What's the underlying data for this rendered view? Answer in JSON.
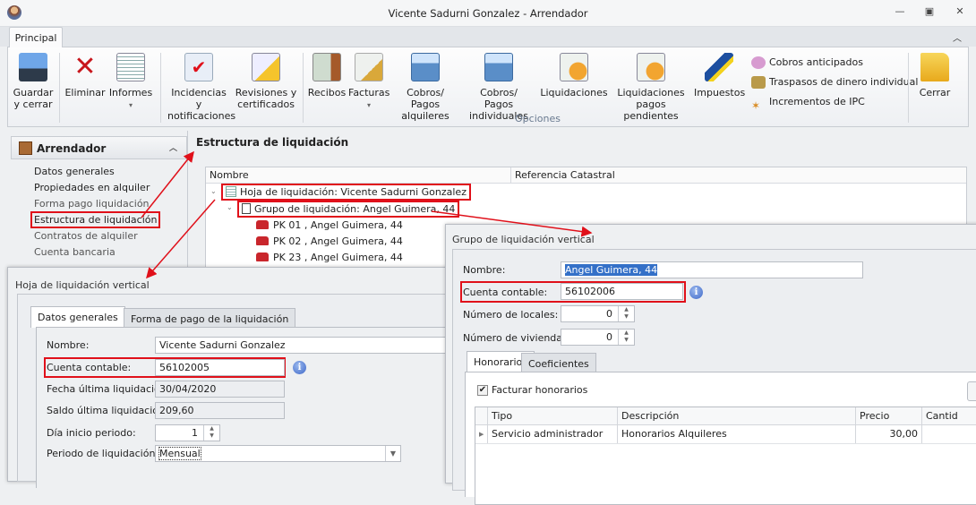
{
  "window": {
    "title": "Vicente Sadurni Gonzalez - Arrendador",
    "controls": [
      "minimize-icon",
      "restore-icon",
      "close-icon"
    ]
  },
  "ribbon": {
    "tab": "Principal",
    "buttons": [
      {
        "label1": "Guardar",
        "label2": "y cerrar",
        "icon": "floppy-disk-icon"
      },
      {
        "label1": "Eliminar",
        "label2": "",
        "icon": "red-x-icon"
      },
      {
        "label1": "Informes",
        "label2": "▾",
        "icon": "report-icon"
      },
      {
        "label1": "Incidencias y",
        "label2": "notificaciones",
        "icon": "mail-check-icon"
      },
      {
        "label1": "Revisiones y",
        "label2": "certificados",
        "icon": "bell-document-icon"
      },
      {
        "label1": "Recibos",
        "label2": "",
        "icon": "receipt-icon"
      },
      {
        "label1": "Facturas",
        "label2": "▾",
        "icon": "invoice-coins-icon"
      },
      {
        "label1": "Cobros/ Pagos",
        "label2": "alquileres",
        "icon": "calculator-icon"
      },
      {
        "label1": "Cobros/ Pagos",
        "label2": "individuales",
        "icon": "calculator-person-icon"
      },
      {
        "label1": "Liquidaciones",
        "label2": "",
        "icon": "certificate-icon"
      },
      {
        "label1": "Liquidaciones",
        "label2": "pagos pendientes",
        "icon": "certificate-icon"
      },
      {
        "label1": "Impuestos",
        "label2": "",
        "icon": "tax-agency-icon"
      },
      {
        "label1": "Cerrar",
        "label2": "",
        "icon": "folder-exit-icon"
      }
    ],
    "small_items": [
      "Cobros anticipados",
      "Traspasos de dinero individual",
      "Incrementos de IPC"
    ],
    "group_label": "Opciones"
  },
  "sidebar": {
    "header": "Arrendador",
    "items": [
      "Datos generales",
      "Propiedades en alquiler",
      "Forma pago liquidación",
      "Estructura de liquidación",
      "Contratos de alquiler",
      "Cuenta bancaria"
    ]
  },
  "structure": {
    "title": "Estructura de liquidación",
    "columns": [
      "Nombre",
      "Referencia Catastral"
    ],
    "hoja": "Hoja de liquidación: Vicente Sadurni Gonzalez",
    "grupo": "Grupo de liquidación: Angel Guimera, 44",
    "properties": [
      "PK 01 , Angel Guimera, 44",
      "PK 02 , Angel Guimera, 44",
      "PK 23 , Angel Guimera, 44"
    ]
  },
  "hoja_dialog": {
    "title": "Hoja de liquidación vertical",
    "tabs": [
      "Datos generales",
      "Forma de pago de la liquidación"
    ],
    "fields": {
      "nombre_label": "Nombre:",
      "nombre": "Vicente Sadurni Gonzalez",
      "cuenta_label": "Cuenta contable:",
      "cuenta": "56102005",
      "fecha_label": "Fecha última liquidación:",
      "fecha": "30/04/2020",
      "saldo_label": "Saldo última liquidación:",
      "saldo": "209,60",
      "dia_label": "Día inicio periodo:",
      "dia": "1",
      "periodo_label": "Periodo de liquidación:",
      "periodo": "Mensual"
    }
  },
  "grupo_dialog": {
    "title": "Grupo de liquidación vertical",
    "fields": {
      "nombre_label": "Nombre:",
      "nombre": "Angel Guimera, 44",
      "cuenta_label": "Cuenta contable:",
      "cuenta": "56102006",
      "locales_label": "Número de locales:",
      "locales": "0",
      "viviendas_label": "Número de viviendas:",
      "viviendas": "0"
    },
    "tabs": [
      "Honorarios",
      "Coeficientes"
    ],
    "facturar_label": "Facturar honorarios",
    "facturar_checked": true,
    "grid": {
      "columns": [
        "Tipo",
        "Descripción",
        "Precio",
        "Cantid"
      ],
      "rows": [
        {
          "tipo": "Servicio administrador",
          "descripcion": "Honorarios Alquileres",
          "precio": "30,00"
        }
      ]
    }
  },
  "colors": {
    "highlight": "#e0101a",
    "selection": "#3470c8"
  }
}
